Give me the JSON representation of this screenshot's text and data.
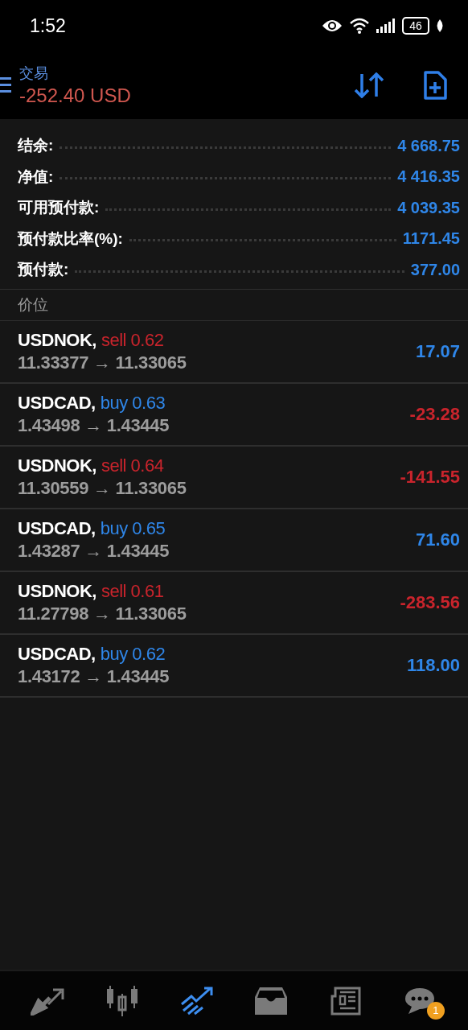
{
  "status_bar": {
    "time": "1:52",
    "battery": "46"
  },
  "header": {
    "title": "交易",
    "balance": "-252.40 USD"
  },
  "summary": [
    {
      "label": "结余:",
      "value": "4 668.75"
    },
    {
      "label": "净值:",
      "value": "4 416.35"
    },
    {
      "label": "可用预付款:",
      "value": "4 039.35"
    },
    {
      "label": "预付款比率(%):",
      "value": "1171.45"
    },
    {
      "label": "预付款:",
      "value": "377.00"
    }
  ],
  "section_title": "价位",
  "positions": [
    {
      "symbol": "USDNOK,",
      "kind": "sell",
      "order": "sell 0.62",
      "prices": "11.33377 → 11.33065",
      "profit": "17.07",
      "loss": false
    },
    {
      "symbol": "USDCAD,",
      "kind": "buy",
      "order": "buy 0.63",
      "prices": "1.43498 → 1.43445",
      "profit": "-23.28",
      "loss": true
    },
    {
      "symbol": "USDNOK,",
      "kind": "sell",
      "order": "sell 0.64",
      "prices": "11.30559 → 11.33065",
      "profit": "-141.55",
      "loss": true
    },
    {
      "symbol": "USDCAD,",
      "kind": "buy",
      "order": "buy 0.65",
      "prices": "1.43287 → 1.43445",
      "profit": "71.60",
      "loss": false
    },
    {
      "symbol": "USDNOK,",
      "kind": "sell",
      "order": "sell 0.61",
      "prices": "11.27798 → 11.33065",
      "profit": "-283.56",
      "loss": true
    },
    {
      "symbol": "USDCAD,",
      "kind": "buy",
      "order": "buy 0.62",
      "prices": "1.43172 → 1.43445",
      "profit": "118.00",
      "loss": false
    }
  ],
  "nav": [
    {
      "kind": "quotes",
      "selected": false
    },
    {
      "kind": "chart",
      "selected": false
    },
    {
      "kind": "trade",
      "selected": true
    },
    {
      "kind": "history",
      "selected": false
    },
    {
      "kind": "news",
      "selected": false
    },
    {
      "kind": "chat",
      "selected": false,
      "badge": "1"
    }
  ]
}
